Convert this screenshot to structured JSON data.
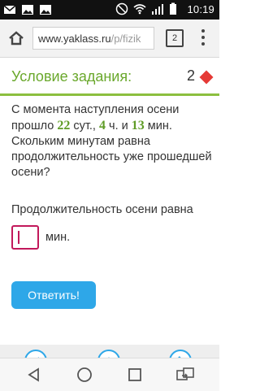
{
  "status_bar": {
    "time": "10:19",
    "icons": [
      "mail-icon",
      "image-icon",
      "image-icon",
      "mute-icon",
      "wifi-icon",
      "signal-icon",
      "battery-icon"
    ]
  },
  "browser": {
    "url_host": "www.yaklass.ru",
    "url_path": "/p/fizik",
    "tabs_count": "2"
  },
  "task": {
    "title": "Условие задания:",
    "points": "2",
    "question_parts": {
      "p1": "С момента наступления осени прошло ",
      "days": "22",
      "p2": " сут., ",
      "hours": "4",
      "p3": " ч. и ",
      "minutes": "13",
      "p4": " мин.",
      "p5": "Скольким минутам равна продолжительность уже прошедшей осени?"
    },
    "answer_label": "Продолжительность осени равна",
    "answer_value": "",
    "unit": "мин.",
    "submit_label": "Ответить!"
  },
  "colors": {
    "accent_green": "#6aa82c",
    "accent_blue": "#2ea7e8",
    "input_border": "#c2185b",
    "diamond": "#e53935"
  }
}
